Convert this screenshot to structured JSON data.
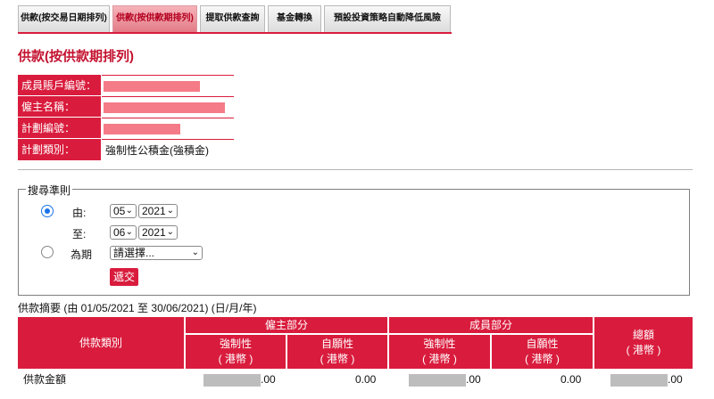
{
  "tabs": [
    {
      "label": "供款(按交易日期排列)",
      "active": false
    },
    {
      "label": "供款(按供款期排列)",
      "active": true
    },
    {
      "label": "提取供款查詢",
      "active": false
    },
    {
      "label": "基金轉換",
      "active": false
    },
    {
      "label": "預設投資策略自動降低風險",
      "active": false
    }
  ],
  "page_title": "供款(按供款期排列)",
  "info": {
    "account_label": "成員賬戶編號：",
    "employer_label": "僱主名稱：",
    "plan_no_label": "計劃編號：",
    "plan_type_label": "計劃類別：",
    "plan_type_value": "強制性公積金(強積金)"
  },
  "criteria": {
    "legend": "搜尋準則",
    "from_label": "由:",
    "to_label": "至:",
    "period_label": "為期",
    "from_month": "05",
    "from_year": "2021",
    "to_month": "06",
    "to_year": "2021",
    "period_placeholder": "請選擇...",
    "submit_label": "遞交"
  },
  "summary": {
    "title": "供款摘要 (由 01/05/2021 至 30/06/2021) (日/月/年)",
    "col_type": "供款類別",
    "employer_part": "僱主部分",
    "member_part": "成員部分",
    "mandatory": "強制性",
    "voluntary": "自願性",
    "hkd": "( 港幣 )",
    "total": "總額",
    "row_label": "供款金額",
    "employer_mandatory_suffix": ".00",
    "employer_voluntary": "0.00",
    "member_mandatory_suffix": ".00",
    "member_voluntary": "0.00",
    "total_suffix": ".00"
  }
}
